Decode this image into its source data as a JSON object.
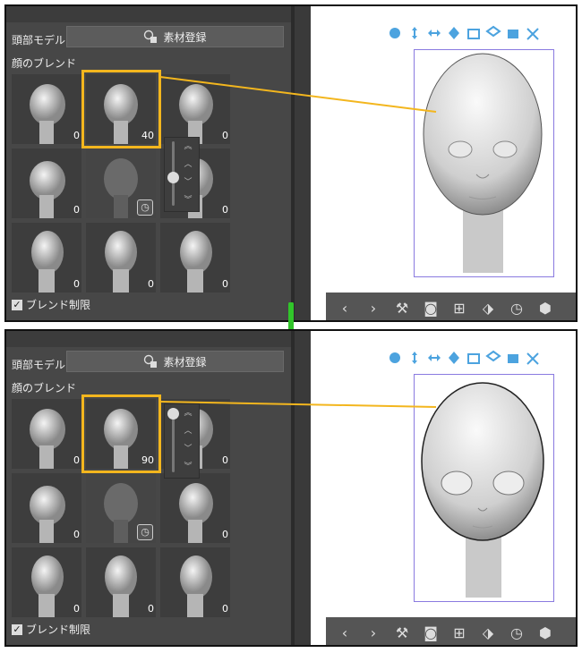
{
  "panels": [
    {
      "header_label": "頭部モデル",
      "register_button": "素材登録",
      "blend_label": "顔のブレンド",
      "checkbox_label": "ブレンド制限",
      "values": [
        "0",
        "40",
        "0",
        "0",
        "",
        "0",
        "0",
        "0",
        "0"
      ]
    },
    {
      "header_label": "頭部モデル",
      "register_button": "素材登録",
      "blend_label": "顔のブレンド",
      "checkbox_label": "ブレンド制限",
      "values": [
        "0",
        "90",
        "0",
        "0",
        "",
        "0",
        "0",
        "0",
        "0"
      ]
    }
  ],
  "accent_color": "#f3b61e",
  "arrow_color": "#31c52a",
  "toolbar_icons": [
    "move-camera-icon",
    "pan-icon",
    "zoom-icon",
    "rotate-icon",
    "camera-front-icon",
    "camera-top-icon",
    "camera-side-icon",
    "camera-reset-icon"
  ],
  "bottom_icons": [
    "chevron-left-icon",
    "chevron-right-icon",
    "wrench-icon",
    "camera-icon",
    "fit-icon",
    "ground-icon",
    "pose-icon",
    "model-icon"
  ]
}
